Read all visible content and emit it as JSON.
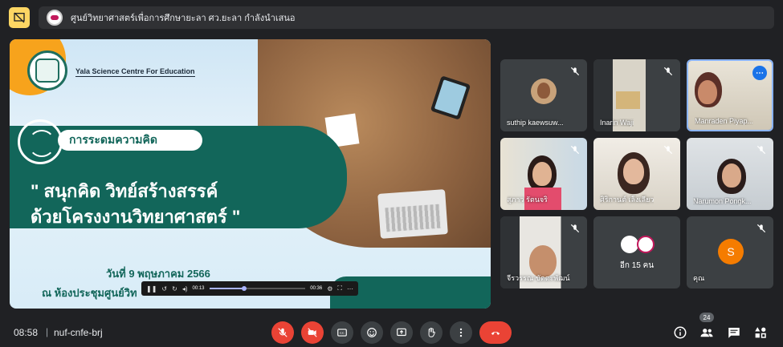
{
  "header": {
    "title": "ศูนย์วิทยาศาสตร์เพื่อการศึกษายะลา ศว.ยะลา กำลังนำเสนอ"
  },
  "slide": {
    "org_name": "Yala Science Centre For Education",
    "tag": "การระดมความคิด",
    "headline_line1": "\" สนุกคิด วิทย์สร้างสรรค์",
    "headline_line2": "ด้วยโครงงานวิทยาศาสตร์ \"",
    "date": "วันที่  9 พฤษภาคม  2566",
    "venue": "ณ ห้องประชุมศูนย์วิท"
  },
  "video_controls": {
    "current_time": "00:13",
    "duration": "00:36",
    "progress": 0.36
  },
  "participants": [
    {
      "name": "suthip kaewsuw...",
      "muted": true
    },
    {
      "name": "Inarin Waji",
      "muted": true
    },
    {
      "name": "Manraden Piyap...",
      "muted": false
    },
    {
      "name": "สุภาว รัตนจริ",
      "muted": true
    },
    {
      "name": "ศิริกานต์ เล็งเลียว",
      "muted": true
    },
    {
      "name": "Narumon Pongk...",
      "muted": true
    },
    {
      "name": "จีรวรรณ ขัดตะพัฒน์",
      "muted": true
    },
    {
      "label": "อีก 15 คน"
    },
    {
      "name": "คุณ",
      "avatar_letter": "S",
      "avatar_color": "#f57c00",
      "muted": true
    }
  ],
  "footer": {
    "time": "08:58",
    "separator": "|",
    "meeting_code": "nuf-cnfe-brj",
    "participant_count": "24"
  },
  "colors": {
    "background": "#202124",
    "end_call": "#ea4335",
    "accent_orange": "#f7a31c",
    "slide_green": "#12665a",
    "present_yellow": "#fdd663"
  }
}
